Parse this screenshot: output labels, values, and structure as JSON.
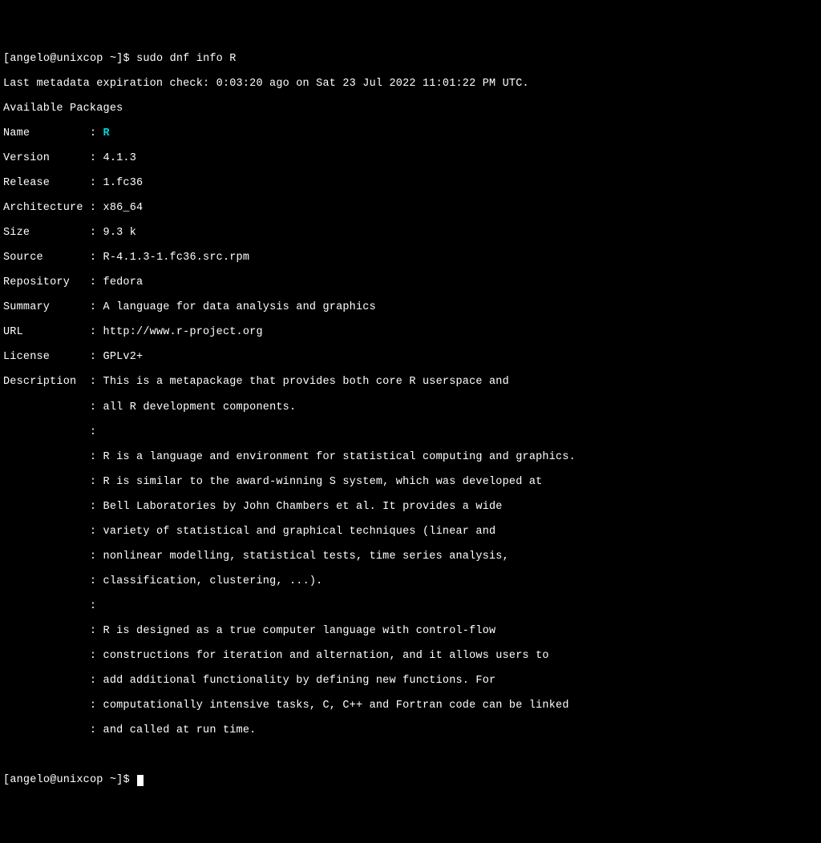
{
  "prompt1": {
    "open": "[",
    "user": "angelo",
    "at": "@",
    "host": "unixcop",
    "path": " ~",
    "close": "]$ ",
    "command": "sudo dnf info R"
  },
  "meta": {
    "expiration": "Last metadata expiration check: 0:03:20 ago on Sat 23 Jul 2022 11:01:22 PM UTC.",
    "available": "Available Packages"
  },
  "fields": {
    "name_label": "Name         : ",
    "name_value": "R",
    "version_label": "Version      : ",
    "version_value": "4.1.3",
    "release_label": "Release      : ",
    "release_value": "1.fc36",
    "arch_label": "Architecture : ",
    "arch_value": "x86_64",
    "size_label": "Size         : ",
    "size_value": "9.3 k",
    "source_label": "Source       : ",
    "source_value": "R-4.1.3-1.fc36.src.rpm",
    "repo_label": "Repository   : ",
    "repo_value": "fedora",
    "summary_label": "Summary      : ",
    "summary_value": "A language for data analysis and graphics",
    "url_label": "URL          : ",
    "url_value": "http://www.r-project.org",
    "license_label": "License      : ",
    "license_value": "GPLv2+",
    "desc_label": "Description  : ",
    "desc_l1": "This is a metapackage that provides both core R userspace and",
    "cont": "             : ",
    "desc_l2": "all R development components.",
    "blank_cont": "             :",
    "desc_l3": "R is a language and environment for statistical computing and graphics.",
    "desc_l4": "R is similar to the award-winning S system, which was developed at",
    "desc_l5": "Bell Laboratories by John Chambers et al. It provides a wide",
    "desc_l6": "variety of statistical and graphical techniques (linear and",
    "desc_l7": "nonlinear modelling, statistical tests, time series analysis,",
    "desc_l8": "classification, clustering, ...).",
    "desc_l9": "R is designed as a true computer language with control-flow",
    "desc_l10": "constructions for iteration and alternation, and it allows users to",
    "desc_l11": "add additional functionality by defining new functions. For",
    "desc_l12": "computationally intensive tasks, C, C++ and Fortran code can be linked",
    "desc_l13": "and called at run time."
  },
  "prompt2": {
    "open": "[",
    "user": "angelo",
    "at": "@",
    "host": "unixcop",
    "path": " ~",
    "close": "]$ "
  }
}
